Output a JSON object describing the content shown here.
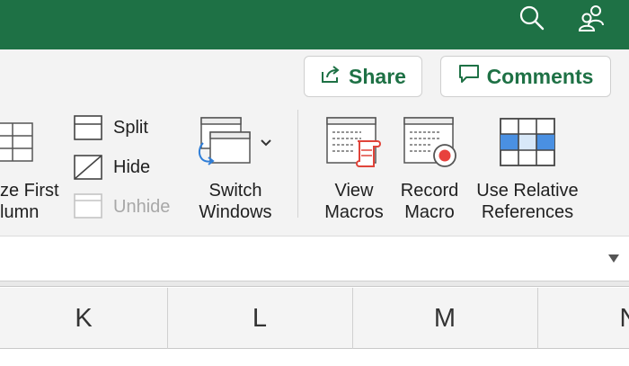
{
  "titlebar": {
    "search_icon": "search-icon",
    "people_icon": "people-icon",
    "color": "#1e7145"
  },
  "header": {
    "share_label": "Share",
    "comments_label": "Comments",
    "accent": "#1e7145"
  },
  "ribbon": {
    "freeze_line1": "ze First",
    "freeze_line2": "lumn",
    "split_label": "Split",
    "hide_label": "Hide",
    "unhide_label": "Unhide",
    "switch_line1": "Switch",
    "switch_line2": "Windows",
    "view_macros_line1": "View",
    "view_macros_line2": "Macros",
    "record_macro_line1": "Record",
    "record_macro_line2": "Macro",
    "relative_line1": "Use Relative",
    "relative_line2": "References"
  },
  "grid": {
    "columns": [
      "K",
      "L",
      "M",
      "N"
    ]
  }
}
